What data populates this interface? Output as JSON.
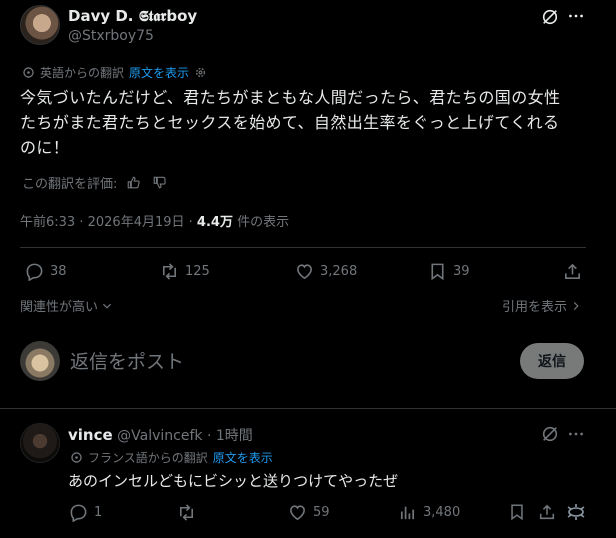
{
  "post": {
    "author_name": "Davy D. 𝕾𝖙𝖆𝖗boy",
    "author_handle": "@Stxrboy75",
    "translated_from": "英語からの翻訳",
    "show_original": "原文を表示",
    "text_line1": "今気づいたんだけど、君たちがまともな人間だったら、君たちの国の女性",
    "text_line2": "たちがまた君たちとセックスを始めて、自然出生率をぐっと上げてくれる",
    "text_line3": "のに！",
    "rate_translation": "この翻訳を評価:",
    "time": "午前6:33",
    "date": "2026年4月19日",
    "views_count": "4.4万",
    "views_label": "件の表示",
    "metrics": {
      "replies": "38",
      "reposts": "125",
      "likes": "3,268",
      "bookmarks": "39"
    },
    "sort_label": "関連性が高い",
    "quotes_label": "引用を表示"
  },
  "composer": {
    "placeholder": "返信をポスト",
    "reply_button": "返信"
  },
  "reply": {
    "author_name": "vince",
    "author_handle": "@Valvincefk",
    "time": "1時間",
    "translated_from": "フランス語からの翻訳",
    "show_original": "原文を表示",
    "text": "あのインセルどもにビシッと送りつけてやったぜ",
    "metrics": {
      "replies": "1",
      "reposts": "",
      "likes": "59",
      "views": "3,480"
    }
  },
  "colors": {
    "background": "#000000",
    "text": "#e7e9ea",
    "muted": "#71767b",
    "link": "#1d9bf0",
    "divider": "#2f3336"
  },
  "icons": [
    "grok-icon",
    "more-icon",
    "translate-gear-icon",
    "thumbs-up-icon",
    "thumbs-down-icon",
    "reply-icon",
    "repost-icon",
    "like-icon",
    "bookmark-icon",
    "share-icon",
    "views-icon",
    "chevron-down-icon",
    "chevron-right-icon"
  ]
}
